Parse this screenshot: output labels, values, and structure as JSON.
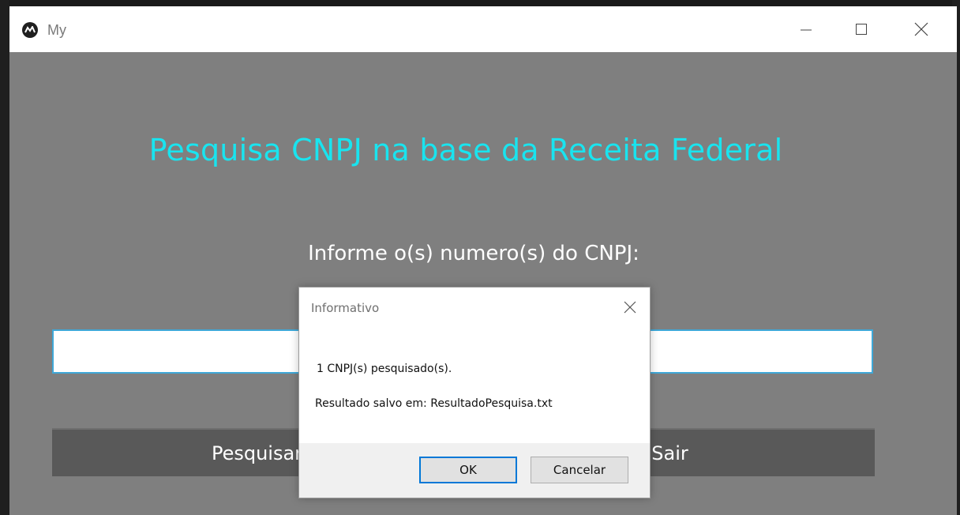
{
  "window": {
    "title": "My",
    "controls": {
      "minimize_icon": "minimize-icon",
      "maximize_icon": "maximize-icon",
      "close_icon": "close-icon"
    }
  },
  "main": {
    "heading": "Pesquisa CNPJ na base da Receita Federal",
    "prompt": "Informe o(s) numero(s) do CNPJ:",
    "cnpj_input_value": "",
    "buttons": {
      "search_label": "Pesquisar",
      "exit_label": "Sair"
    }
  },
  "dialog": {
    "title": "Informativo",
    "line1": "1 CNPJ(s) pesquisado(s).",
    "line2": "Resultado salvo em: ResultadoPesquisa.txt",
    "ok_label": "OK",
    "cancel_label": "Cancelar"
  },
  "colors": {
    "heading": "#19e4ef",
    "window_body": "#7f7f7f",
    "app_button": "#595959",
    "focus_border": "#0078d7"
  }
}
